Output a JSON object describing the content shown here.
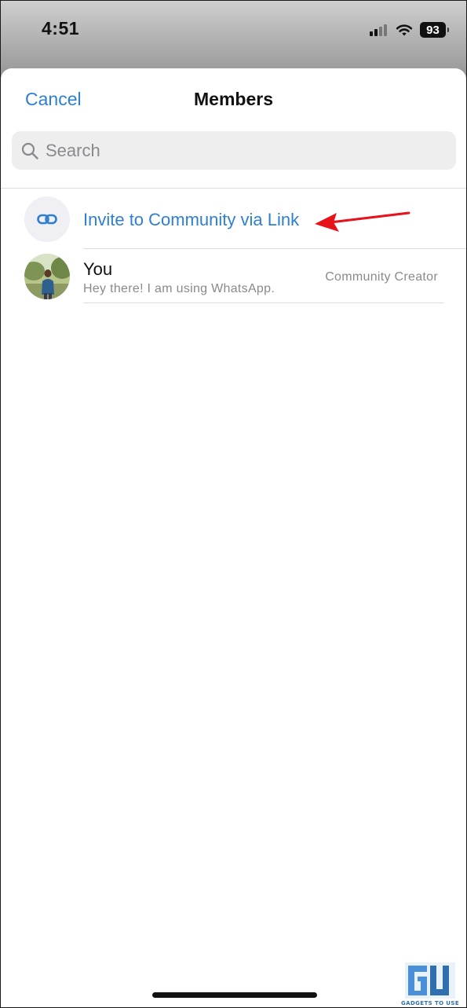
{
  "status_bar": {
    "time": "4:51",
    "battery": "93",
    "icons": [
      "signal-icon",
      "wifi-icon",
      "battery-icon"
    ]
  },
  "header": {
    "cancel_label": "Cancel",
    "title": "Members"
  },
  "search": {
    "placeholder": "Search",
    "value": ""
  },
  "invite": {
    "label": "Invite to Community via Link",
    "icon": "link-icon"
  },
  "members": [
    {
      "name": "You",
      "status": "Hey there! I am using WhatsApp.",
      "role": "Community Creator"
    }
  ],
  "watermark": {
    "text": "GADGETS TO USE"
  },
  "colors": {
    "accent": "#2f7fd1",
    "annotation_arrow": "#e8121b",
    "secondary_text": "#8a8a8e"
  }
}
